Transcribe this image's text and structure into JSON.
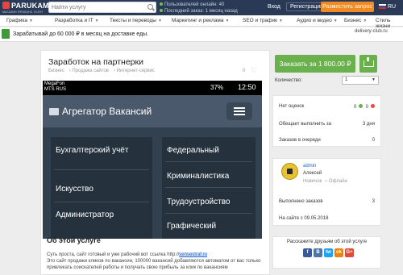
{
  "header": {
    "logo_text": "PARUKAM",
    "logo_sub": "МАГАЗИН ФРИЛАНС УСЛУГ",
    "search_placeholder": "Найти услугу",
    "online_users": "Пользователей онлайн: 40",
    "last_order": "Последний заказ: 1 месяц назад",
    "login": "Вход",
    "register": "Регистрация",
    "post_service": "Разместить запрос",
    "language": "RU"
  },
  "categories": [
    "Графика",
    "Разработка и IT",
    "Тексты и переводы",
    "Маркетинг и реклама",
    "SEO и трафик",
    "Аудио и видео",
    "Бизнес",
    "Стиль жизни"
  ],
  "banner": {
    "text": "Зарабатывай до 60 000 ₽ в месяц на доставке еды.",
    "site": "delivery-club.ru"
  },
  "service": {
    "title": "Заработок на партнерки",
    "breadcrumbs": [
      "Бизнес",
      "Продажа сайтов",
      "Интернет-сервис"
    ],
    "likes": "0",
    "screenshot": {
      "operator": "MegaFon",
      "operator2": "MTS RUS",
      "battery": "37%",
      "time": "12:50",
      "app_title": "Агрегатор Вакансий",
      "left_items": [
        "Бухгалтерский учёт",
        "Искусство",
        "Администратор"
      ],
      "right_items": [
        "Федеральный",
        "Криминалистика",
        "Трудоустройство",
        "Графический"
      ]
    },
    "about_title": "Об этой услуге",
    "description_pre": "Суть проста, сайт готовый и уже рабочий вот ссылка http://",
    "description_link": "sensestraf.ru",
    "description_post": "Это сайт продажи кликов по вакансии, 100000 вакансий добавляются автоматом от вас только привлекать соискателей работы и получать свою прибыль за клик по вакансиям"
  },
  "order": {
    "button": "Заказать за 1 800.00 ₽",
    "qty_label": "Количество:",
    "qty_value": "1"
  },
  "stats": {
    "no_ratings": "Нет оценок",
    "pos": "0",
    "neg": "0",
    "delivery_label": "Обещает выполнить за",
    "delivery_value": "3 дня",
    "queue_label": "Заказов в очереди",
    "queue_value": "0"
  },
  "seller": {
    "name": "admin",
    "fullname": "Алексей",
    "level": "Новичок",
    "status": "Офлайн",
    "done_label": "Выполнено заказов",
    "done_value": "3",
    "since": "На сайте с 09.05.2018"
  },
  "share": {
    "title": "Расскажите друзьям об этой услуге",
    "icons": [
      "f",
      "В",
      "tw",
      "ok",
      "G+"
    ],
    "colors": [
      "#3b5998",
      "#4a76a8",
      "#1da1f2",
      "#ee8208",
      "#dd4b39"
    ]
  },
  "colors": {
    "topbar": "#2a3a56",
    "accent": "#f08a24",
    "order": "#6ab04c"
  }
}
